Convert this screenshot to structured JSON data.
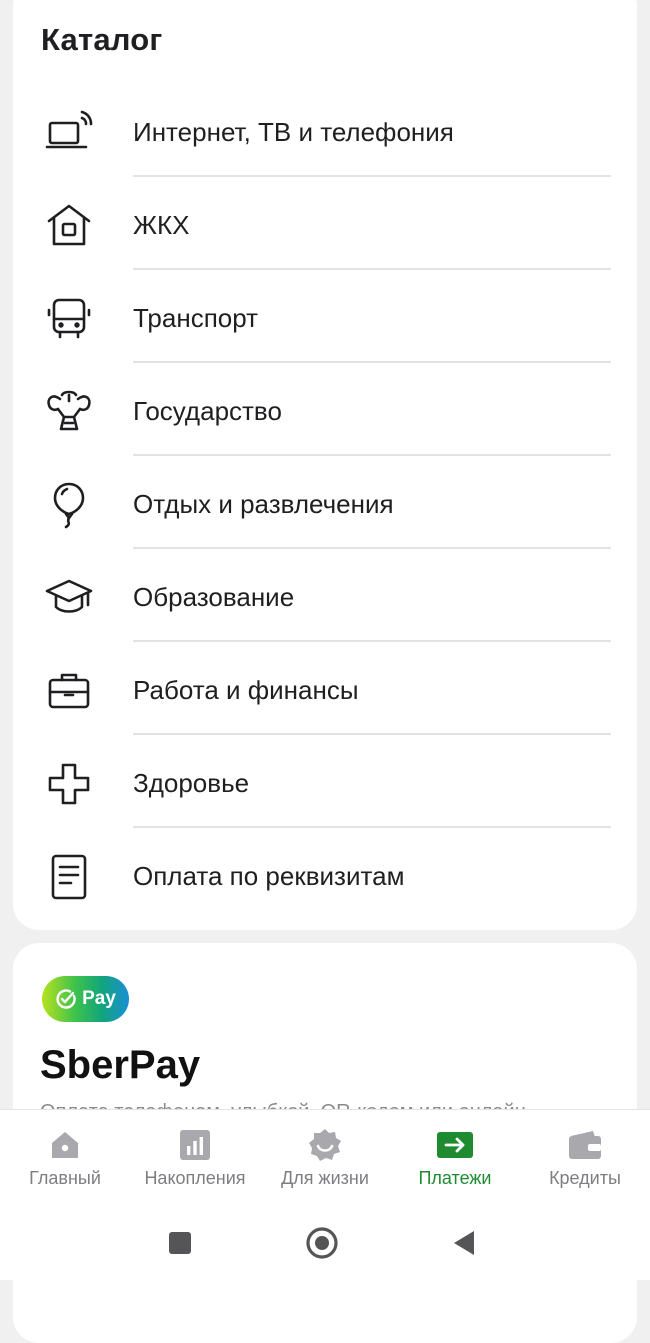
{
  "catalog": {
    "title": "Каталог",
    "items": [
      {
        "label": "Интернет, ТВ и телефония",
        "icon": "laptop-icon"
      },
      {
        "label": "ЖКХ",
        "icon": "house-icon"
      },
      {
        "label": "Транспорт",
        "icon": "bus-icon"
      },
      {
        "label": "Государство",
        "icon": "state-emblem-icon"
      },
      {
        "label": "Отдых и развлечения",
        "icon": "balloon-icon"
      },
      {
        "label": "Образование",
        "icon": "graduation-cap-icon"
      },
      {
        "label": "Работа и финансы",
        "icon": "briefcase-icon"
      },
      {
        "label": "Здоровье",
        "icon": "health-cross-icon"
      },
      {
        "label": "Оплата по реквизитам",
        "icon": "document-icon"
      }
    ]
  },
  "sberpay": {
    "badge_text": "Pay",
    "title": "SberPay",
    "description": "Оплата телефоном, улыбкой, QR-кодом или онлайн"
  },
  "bottom_nav": {
    "items": [
      {
        "label": "Главный",
        "icon": "home-icon",
        "active": false
      },
      {
        "label": "Накопления",
        "icon": "chart-icon",
        "active": false
      },
      {
        "label": "Для жизни",
        "icon": "smile-badge-icon",
        "active": false
      },
      {
        "label": "Платежи",
        "icon": "payments-arrow-icon",
        "active": true
      },
      {
        "label": "Кредиты",
        "icon": "wallet-icon",
        "active": false
      }
    ]
  },
  "colors": {
    "accent": "#1e8b31",
    "inactive": "#7d7d82",
    "icon_gray": "#a8a8ad",
    "background": "#f0f0f0"
  }
}
